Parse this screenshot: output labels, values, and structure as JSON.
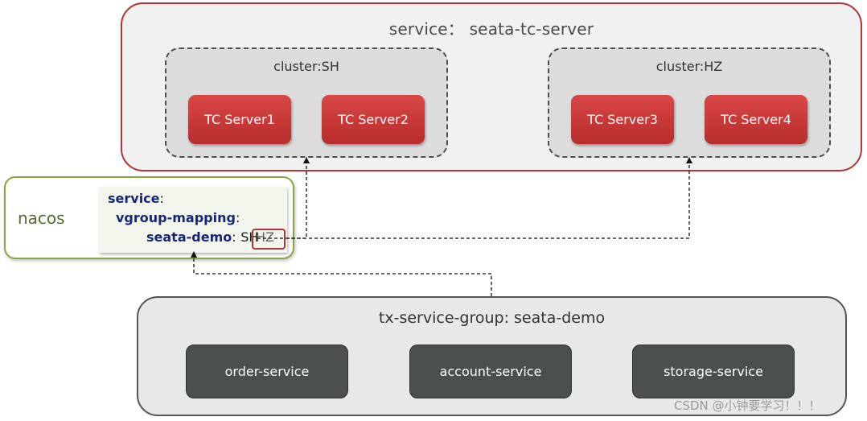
{
  "service": {
    "title": "service： seata-tc-server",
    "clusters": [
      {
        "label": "cluster:SH",
        "servers": [
          "TC Server1",
          "TC Server2"
        ]
      },
      {
        "label": "cluster:HZ",
        "servers": [
          "TC Server3",
          "TC Server4"
        ]
      }
    ]
  },
  "nacos": {
    "label": "nacos",
    "config": {
      "line1_key": "service",
      "line2_key": "vgroup-mapping",
      "line3_key": "seata-demo",
      "line3_value": "SH",
      "highlight_value": "HZ",
      "colon": ":"
    }
  },
  "tx_group": {
    "title": "tx-service-group: seata-demo",
    "services": [
      "order-service",
      "account-service",
      "storage-service"
    ]
  },
  "watermark": "CSDN @小钟要学习！！！",
  "colors": {
    "service_border": "#b23636",
    "tc_server": "#c93a3a",
    "nacos_border": "#86a649",
    "service_box": "#4b4f4f"
  }
}
